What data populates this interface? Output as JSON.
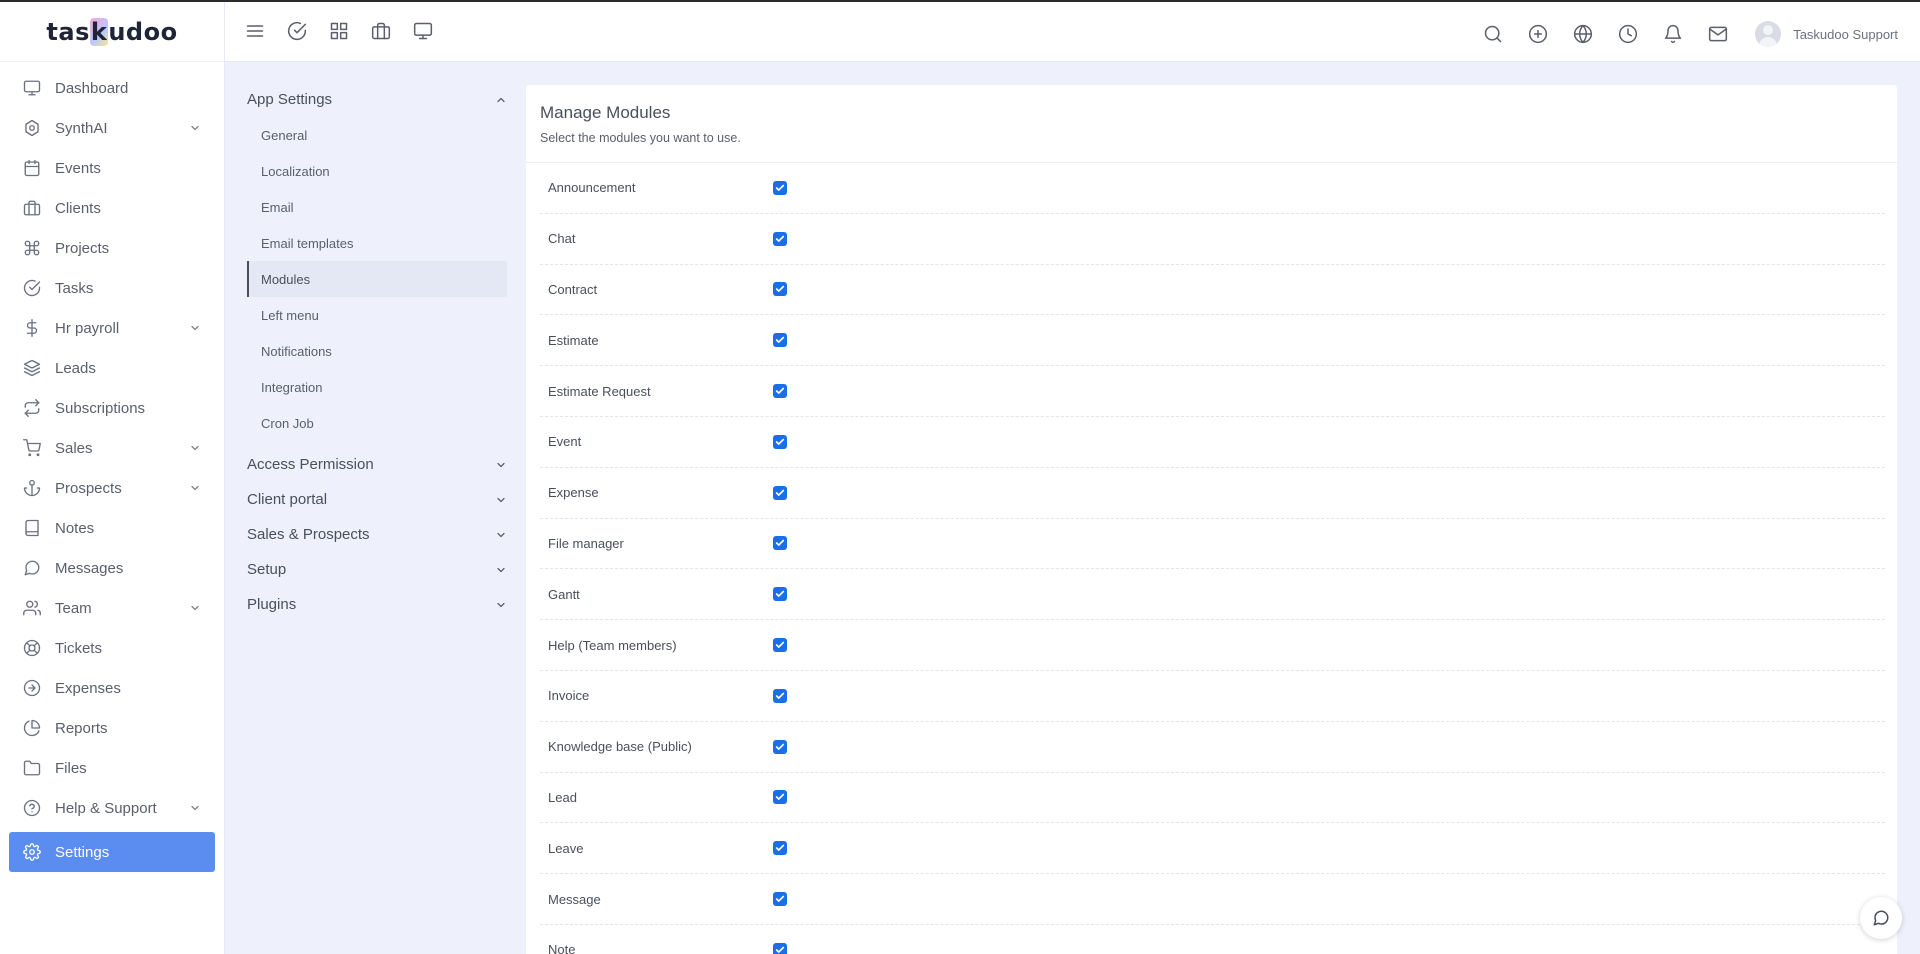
{
  "brand": {
    "logo_text_pre": "tas",
    "logo_text_k": "k",
    "logo_text_post": "udoo"
  },
  "sidebar": {
    "items": [
      {
        "label": "Dashboard",
        "icon": "monitor-icon",
        "has_chevron": false
      },
      {
        "label": "SynthAI",
        "icon": "ai-icon",
        "has_chevron": true
      },
      {
        "label": "Events",
        "icon": "calendar-icon",
        "has_chevron": false
      },
      {
        "label": "Clients",
        "icon": "briefcase-icon",
        "has_chevron": false
      },
      {
        "label": "Projects",
        "icon": "command-icon",
        "has_chevron": false
      },
      {
        "label": "Tasks",
        "icon": "check-circle-icon",
        "has_chevron": false
      },
      {
        "label": "Hr payroll",
        "icon": "dollar-icon",
        "has_chevron": true
      },
      {
        "label": "Leads",
        "icon": "layers-icon",
        "has_chevron": false
      },
      {
        "label": "Subscriptions",
        "icon": "repeat-icon",
        "has_chevron": false
      },
      {
        "label": "Sales",
        "icon": "cart-icon",
        "has_chevron": true
      },
      {
        "label": "Prospects",
        "icon": "anchor-icon",
        "has_chevron": true
      },
      {
        "label": "Notes",
        "icon": "book-icon",
        "has_chevron": false
      },
      {
        "label": "Messages",
        "icon": "message-icon",
        "has_chevron": false
      },
      {
        "label": "Team",
        "icon": "users-icon",
        "has_chevron": true
      },
      {
        "label": "Tickets",
        "icon": "life-buoy-icon",
        "has_chevron": false
      },
      {
        "label": "Expenses",
        "icon": "arrow-circle-icon",
        "has_chevron": false
      },
      {
        "label": "Reports",
        "icon": "pie-chart-icon",
        "has_chevron": false
      },
      {
        "label": "Files",
        "icon": "folder-icon",
        "has_chevron": false
      },
      {
        "label": "Help & Support",
        "icon": "help-circle-icon",
        "has_chevron": true
      },
      {
        "label": "Settings",
        "icon": "gear-icon",
        "has_chevron": false,
        "active": true
      }
    ]
  },
  "topbar": {
    "left_icons": [
      "menu-icon",
      "check-circle-icon",
      "grid-icon",
      "briefcase-icon",
      "monitor-icon"
    ],
    "right_icons": [
      "search-icon",
      "plus-circle-icon",
      "globe-icon",
      "clock-icon",
      "bell-icon",
      "mail-icon"
    ],
    "user_name": "Taskudoo Support"
  },
  "settings_menu": {
    "app_settings": {
      "label": "App Settings",
      "items": [
        "General",
        "Localization",
        "Email",
        "Email templates",
        "Modules",
        "Left menu",
        "Notifications",
        "Integration",
        "Cron Job"
      ],
      "active": "Modules"
    },
    "groups": [
      "Access Permission",
      "Client portal",
      "Sales & Prospects",
      "Setup",
      "Plugins"
    ]
  },
  "panel": {
    "title": "Manage Modules",
    "subtitle": "Select the modules you want to use.",
    "modules": [
      {
        "name": "Announcement",
        "checked": true
      },
      {
        "name": "Chat",
        "checked": true
      },
      {
        "name": "Contract",
        "checked": true
      },
      {
        "name": "Estimate",
        "checked": true
      },
      {
        "name": "Estimate Request",
        "checked": true
      },
      {
        "name": "Event",
        "checked": true
      },
      {
        "name": "Expense",
        "checked": true
      },
      {
        "name": "File manager",
        "checked": true
      },
      {
        "name": "Gantt",
        "checked": true
      },
      {
        "name": "Help (Team members)",
        "checked": true
      },
      {
        "name": "Invoice",
        "checked": true
      },
      {
        "name": "Knowledge base (Public)",
        "checked": true
      },
      {
        "name": "Lead",
        "checked": true
      },
      {
        "name": "Leave",
        "checked": true
      },
      {
        "name": "Message",
        "checked": true
      },
      {
        "name": "Note",
        "checked": true
      }
    ]
  },
  "colors": {
    "accent": "#5b8cf0",
    "checkbox": "#1a6fe8",
    "background": "#eef1fb"
  }
}
